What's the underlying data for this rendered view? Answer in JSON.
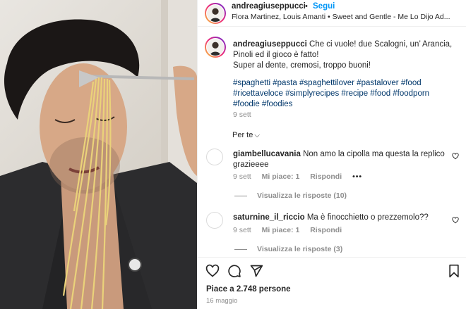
{
  "post": {
    "username": "andreagiuseppucci",
    "follow_label": "Segui",
    "audio_line": "Flora Martinez, Louis Amanti • Sweet and Gentle - Me Lo Dijo Ad..."
  },
  "caption": {
    "username": "andreagiuseppucci",
    "text_line1": "Che ci vuole! due Scalogni, un’ Arancia,",
    "text_line2": "Pinoli ed il gioco è fatto!",
    "text_line3": "Super al dente, cremosi, troppo buoni!",
    "hashtags_line1": "#spaghetti #pasta #spaghettilover #pastalover #food",
    "hashtags_line2": "#ricettaveloce #simplyrecipes #recipe #food #foodporn",
    "hashtags_line3": "#foodie #foodies",
    "time": "9 sett"
  },
  "filter_label": "Per te",
  "comments": [
    {
      "username": "giambellucavania",
      "text_line1": "Non amo la cipolla ma questa la replico",
      "text_line2": "grazieeee",
      "time": "9 sett",
      "likes": "Mi piace: 1",
      "reply": "Rispondi",
      "more": "•••",
      "replies": "Visualizza le risposte (10)"
    },
    {
      "username": "saturnine_il_riccio",
      "text_line1": "Ma è finocchietto o prezzemolo??",
      "time": "9 sett",
      "likes": "Mi piace: 1",
      "reply": "Rispondi",
      "replies": "Visualizza le risposte (3)"
    }
  ],
  "footer": {
    "likes": "Piace a 2.748 persone",
    "date": "16 maggio"
  },
  "icons": [
    "heart-icon",
    "comment-icon",
    "share-icon",
    "bookmark-icon"
  ],
  "colors": {
    "accent": "#0095f6",
    "hashtag": "#00376b",
    "muted": "#8e8e8e"
  }
}
